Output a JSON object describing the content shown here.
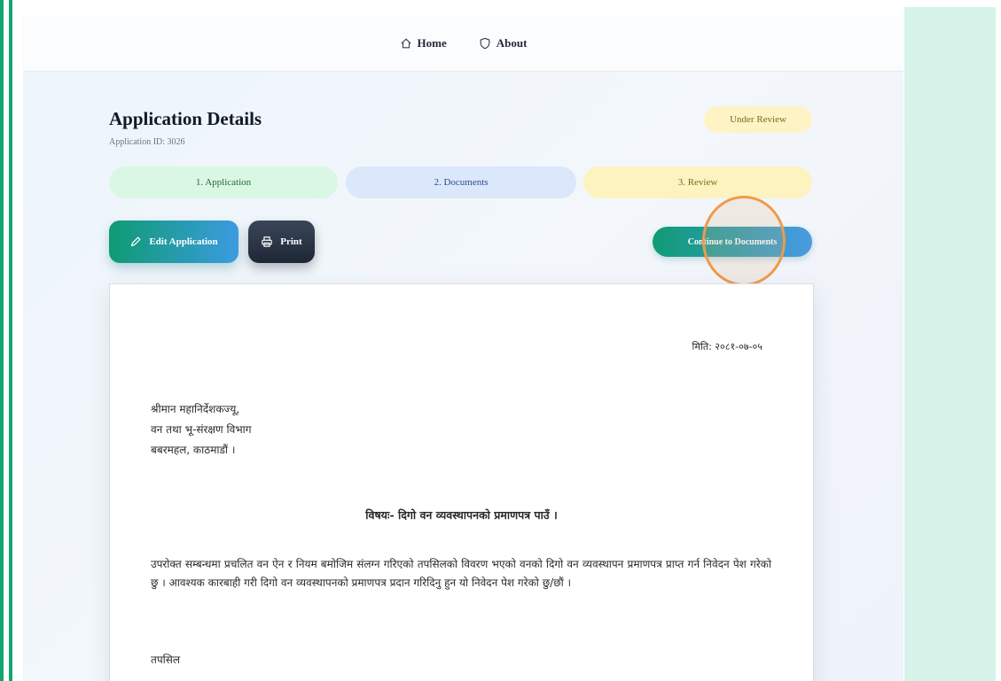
{
  "nav": {
    "home_label": "Home",
    "about_label": "About"
  },
  "header": {
    "title": "Application Details",
    "application_id": "Application ID: 3026",
    "status_badge": "Under Review"
  },
  "steps": [
    {
      "label": "1. Application"
    },
    {
      "label": "2. Documents"
    },
    {
      "label": "3. Review"
    }
  ],
  "actions": {
    "edit_label": "Edit Application",
    "print_label": "Print",
    "continue_label": "Continue to Documents"
  },
  "document": {
    "date": "मिति: २०८१-०७-०५",
    "address_lines": [
      "श्रीमान महानिर्देशकज्यू,",
      "वन तथा भू-संरक्षण विभाग",
      "बबरमहल, काठमाडौं ।"
    ],
    "subject": "विषयः- दिगो वन व्यवस्थापनको प्रमाणपत्र पाउँ ।",
    "body": "उपरोक्त सम्बन्धमा प्रचलित वन ऐन र नियम बमोजिम संलग्न गरिएको तपसिलको विवरण भएको वनको दिगो वन व्यवस्थापन प्रमाणपत्र प्राप्त गर्न निवेदन पेश गरेको छु । आवश्यक कारबाही गरी दिगो वन व्यवस्थापनको प्रमाणपत्र प्रदान गरिदिनु हुन यो निवेदन पेश गरेको छु/छौं ।",
    "details_heading": "तपसिल"
  },
  "colors": {
    "accent_green": "#12a572",
    "accent_blue": "#3b9be0",
    "focus_ring": "#ef9a4a"
  }
}
